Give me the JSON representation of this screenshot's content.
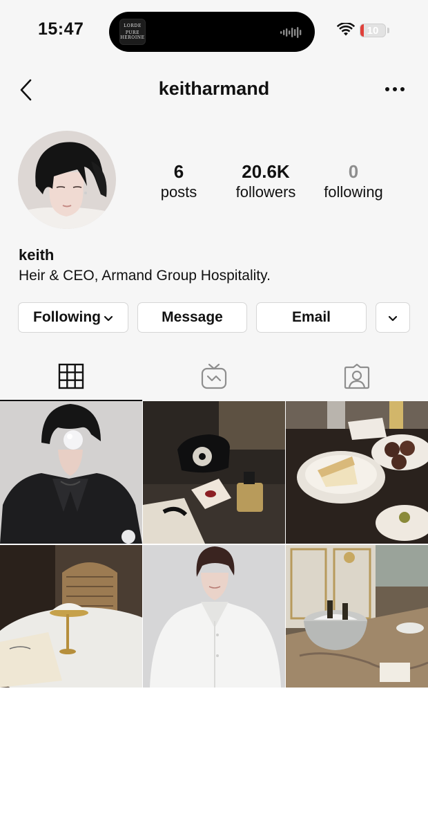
{
  "status_bar": {
    "time": "15:47",
    "battery_level": "10",
    "battery_fraction": 0.1,
    "now_playing": {
      "art_line1": "LORDE",
      "art_line2": "PURE",
      "art_line3": "HEROINE"
    }
  },
  "nav": {
    "username": "keitharmand",
    "back_icon": "chevron-left-icon",
    "more_icon": "more-horizontal-icon"
  },
  "profile": {
    "stats": [
      {
        "value": "6",
        "label": "posts",
        "muted": false
      },
      {
        "value": "20.6K",
        "label": "followers",
        "muted": false
      },
      {
        "value": "0",
        "label": "following",
        "muted": true
      }
    ],
    "name": "keith",
    "bio": "Heir & CEO, Armand Group Hospitality."
  },
  "actions": {
    "following_label": "Following",
    "message_label": "Message",
    "email_label": "Email"
  },
  "tabs": [
    {
      "icon": "grid-icon",
      "active": true
    },
    {
      "icon": "igtv-icon",
      "active": false
    },
    {
      "icon": "tagged-icon",
      "active": false
    }
  ],
  "posts": [
    {
      "subject": "man blowing bubble in black shirt"
    },
    {
      "subject": "rotary phone, perfume and envelope"
    },
    {
      "subject": "cake and desserts on table"
    },
    {
      "subject": "dessert cup on cafe table with menu"
    },
    {
      "subject": "man in white shirt"
    },
    {
      "subject": "champagne bucket in ornate room"
    }
  ],
  "colors": {
    "text": "#111111",
    "muted": "#8e8e8e",
    "battery_low": "#e0403a",
    "button_border": "#d6d6d6"
  }
}
